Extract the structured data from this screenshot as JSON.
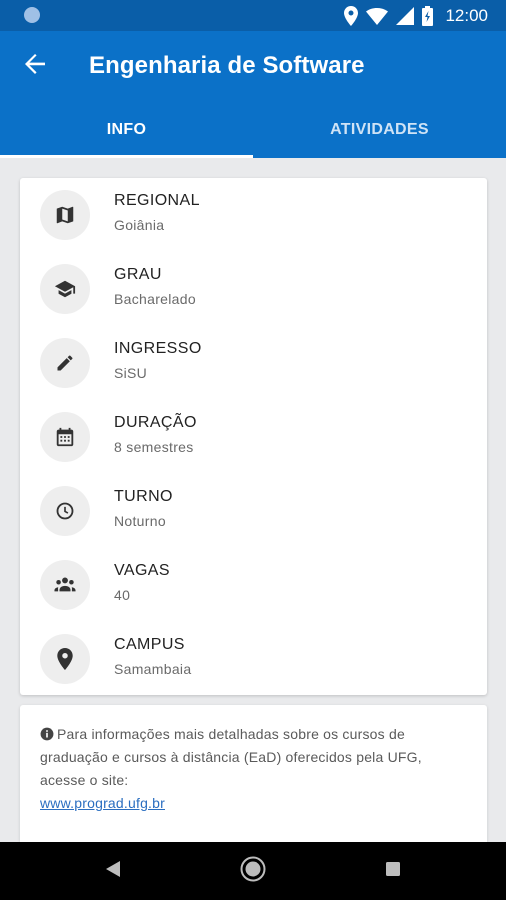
{
  "status_bar": {
    "time": "12:00",
    "icons": [
      "notification-dot-icon",
      "location-icon",
      "wifi-icon",
      "signal-icon",
      "battery-icon"
    ]
  },
  "app_bar": {
    "title": "Engenharia de Software",
    "back_icon": "arrow-back-icon",
    "tabs": [
      {
        "label": "INFO",
        "selected": true
      },
      {
        "label": "ATIVIDADES",
        "selected": false
      }
    ]
  },
  "course_info": [
    {
      "label": "REGIONAL",
      "value": "Goiânia",
      "icon": "map-icon"
    },
    {
      "label": "GRAU",
      "value": "Bacharelado",
      "icon": "graduation-cap-icon"
    },
    {
      "label": "INGRESSO",
      "value": "SiSU",
      "icon": "pencil-icon"
    },
    {
      "label": "DURAÇÃO",
      "value": "8 semestres",
      "icon": "calendar-icon"
    },
    {
      "label": "TURNO",
      "value": "Noturno",
      "icon": "clock-icon"
    },
    {
      "label": "VAGAS",
      "value": "40",
      "icon": "group-icon"
    },
    {
      "label": "CAMPUS",
      "value": "Samambaia",
      "icon": "place-icon"
    }
  ],
  "note": {
    "text": "Para informações mais detalhadas sobre os cursos de graduação e cursos à distância (EaD) oferecidos pela UFG, acesse o site:",
    "link": "www.prograd.ufg.br",
    "icon": "info-icon"
  },
  "nav_bar": {
    "icons": [
      "back-triangle-icon",
      "home-circle-icon",
      "recents-square-icon"
    ]
  },
  "colors": {
    "app_bar": "#0b71c8",
    "status_bar": "#0a5ea8",
    "background": "#e9eaec",
    "link": "#2a6ec0"
  }
}
